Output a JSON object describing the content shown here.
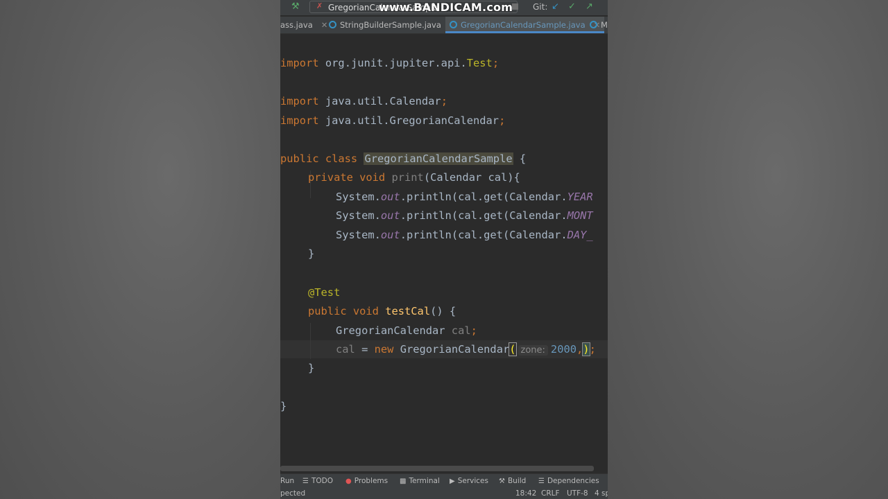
{
  "toolbar": {
    "run_config": "GregorianCalendarSample",
    "watermark": "www.BANDICAM.com",
    "vcs_label": "Git:"
  },
  "tabs": [
    {
      "label": "ass.java",
      "active": false
    },
    {
      "label": "StringBuilderSample.java",
      "active": false
    },
    {
      "label": "GregorianCalendarSample.java",
      "active": true
    },
    {
      "label": "M",
      "active": false
    }
  ],
  "code": {
    "import_kw": "import",
    "l1_path": "org.junit.jupiter.api.",
    "l1_cls": "Test",
    "l1_semi": ";",
    "l3_path": "java.util.Calendar",
    "l3_semi": ";",
    "l4_path": "java.util.GregorianCalendar",
    "l4_semi": ";",
    "public_class": "public class",
    "class_name": "GregorianCalendarSample",
    "brace_open": " {",
    "private_void": "private void",
    "method_print": "print",
    "print_params": "(Calendar cal){",
    "sys": "System.",
    "out": "out",
    "println": ".println(cal.get(Calendar.",
    "field_year": "YEAR",
    "field_month": "MONT",
    "field_day": "DAY_",
    "close_brace": "}",
    "annotation": "@Test",
    "public_void": "public void",
    "method_test": "testCal",
    "test_sig": "() {",
    "decl_type": "GregorianCalendar ",
    "decl_var": "cal",
    "decl_semi": ";",
    "assign_var": "cal",
    "assign_eq": " = ",
    "new_kw": "new",
    "ctor": " GregorianCalendar",
    "paren_open": "(",
    "param_hint": "zone:",
    "arg_year": "2000",
    "comma": ",",
    "paren_close": ")",
    "end_semi": ";"
  },
  "tool_windows": [
    {
      "label": "Run",
      "icon": "run-icon"
    },
    {
      "label": "TODO",
      "icon": "list-icon"
    },
    {
      "label": "Problems",
      "icon": "error-icon"
    },
    {
      "label": "Terminal",
      "icon": "terminal-icon"
    },
    {
      "label": "Services",
      "icon": "services-icon"
    },
    {
      "label": "Build",
      "icon": "hammer-icon"
    },
    {
      "label": "Dependencies",
      "icon": "stack-icon"
    }
  ],
  "status": {
    "message": "pected",
    "position": "18:42",
    "line_sep": "CRLF",
    "encoding": "UTF-8",
    "indent": "4 sp"
  },
  "colors": {
    "keyword": "#cc7832",
    "annotation": "#bbb529",
    "field": "#9876aa",
    "number": "#6897bb",
    "text": "#a9b7c6",
    "editor_bg": "#2b2b2b"
  }
}
